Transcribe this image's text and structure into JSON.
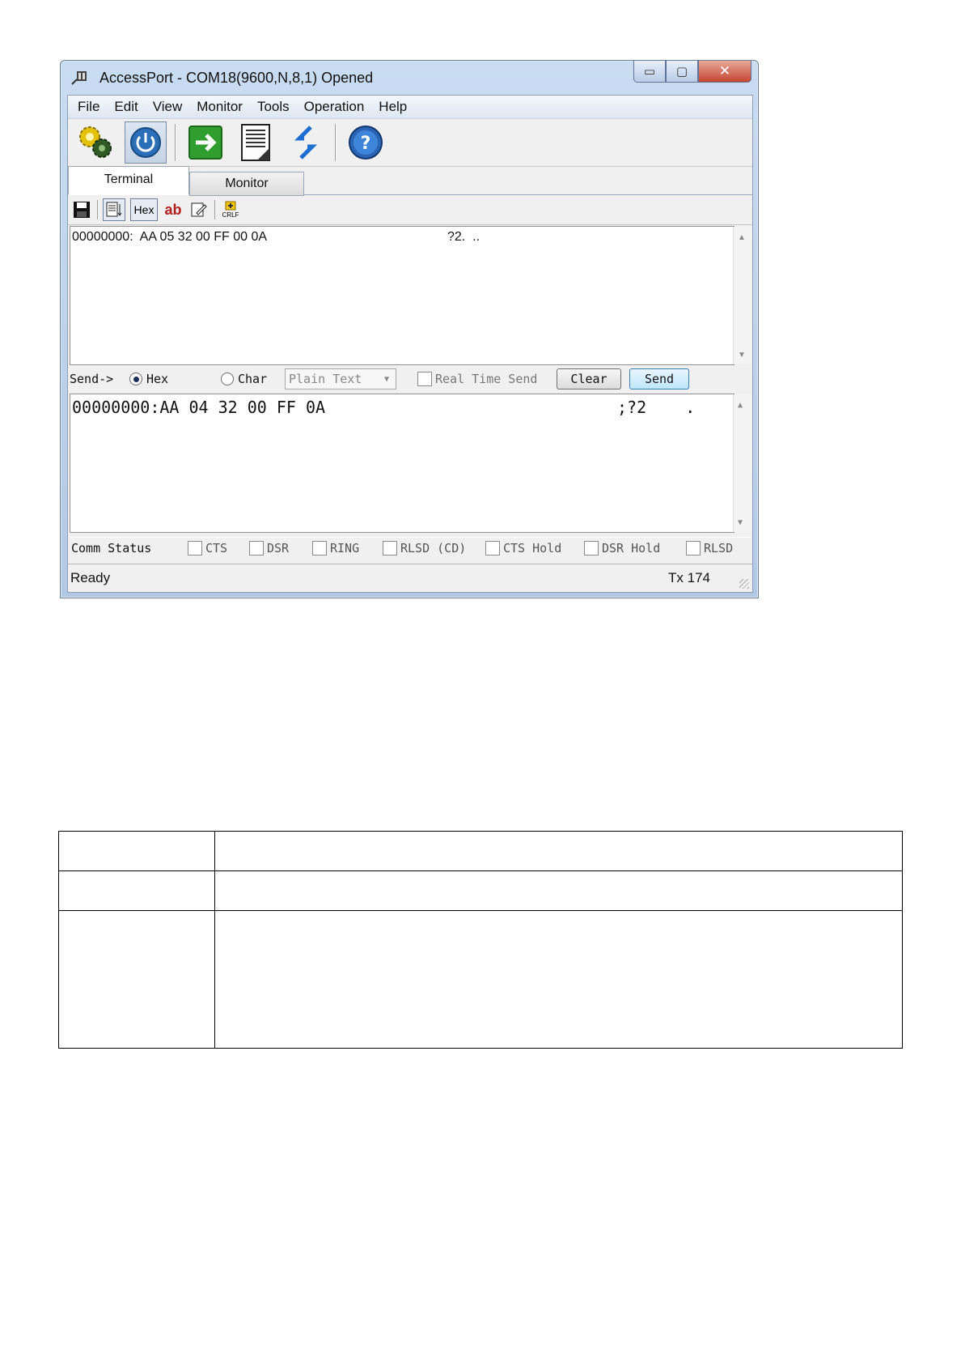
{
  "window": {
    "title": "AccessPort - COM18(9600,N,8,1) Opened",
    "controls": {
      "minimize": "▭",
      "maximize": "▢",
      "close": "✕"
    }
  },
  "menu": [
    "File",
    "Edit",
    "View",
    "Monitor",
    "Tools",
    "Operation",
    "Help"
  ],
  "toolbar": {
    "icons": [
      "settings-gears-icon",
      "power-icon",
      "arrow-right-icon",
      "document-icon",
      "refresh-arrows-icon",
      "help-icon"
    ]
  },
  "tabs": {
    "terminal": "Terminal",
    "monitor": "Monitor"
  },
  "subtoolbar": {
    "hex_label": "Hex",
    "ab_label": "ab",
    "crlf_label": "CRLF"
  },
  "receive": {
    "line": "00000000:  AA 05 32 00 FF 00 0A",
    "ascii": "?2.  .."
  },
  "send": {
    "label": "Send->",
    "hex_label": "Hex",
    "char_label": "Char",
    "format_value": "Plain Text",
    "realtime_label": "Real Time Send",
    "clear_label": "Clear",
    "send_label": "Send",
    "selected": "hex"
  },
  "transmit": {
    "line": "00000000:AA 04 32 00 FF 0A",
    "ascii": ";?2    ."
  },
  "comm_status": {
    "label": "Comm Status",
    "items": [
      "CTS",
      "DSR",
      "RING",
      "RLSD (CD)",
      "CTS Hold",
      "DSR Hold",
      "RLSD"
    ]
  },
  "status": {
    "text": "Ready",
    "tx": "Tx 174"
  },
  "colors": {
    "accent": "#3c7fb1",
    "close_red": "#c54631"
  }
}
